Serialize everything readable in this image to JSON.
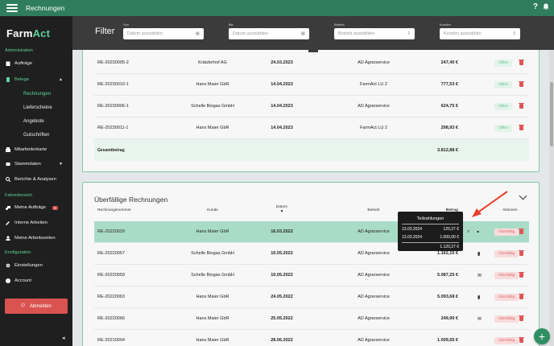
{
  "topbar": {
    "title": "Rechnungen",
    "help": "?",
    "bell": "bell-icon"
  },
  "sidebar": {
    "logo_a": "Farm",
    "logo_b": "Act",
    "section_admin": "Administration",
    "auftraege": "Aufträge",
    "belege": "Belege",
    "rechnungen": "Rechnungen",
    "lieferscheine": "Lieferscheine",
    "angebote": "Angebote",
    "gutschriften": "Gutschriften",
    "mitarbeiterkarte": "Mitarbeiterkarte",
    "stammdaten": "Stammdaten",
    "berichte": "Berichte & Analysen",
    "section_fahrer": "Fahrerbereich",
    "meine_auftraege": "Meine Aufträge",
    "meine_auftraege_badge": "4",
    "interne_arbeiten": "Interne Arbeiten",
    "arbeitszeiten": "Meine Arbeitszeiten",
    "section_konf": "Konfiguration",
    "einstellungen": "Einstellungen",
    "account": "Account",
    "abmelden": "Abmelden"
  },
  "filter": {
    "title": "Filter",
    "von_label": "Von",
    "von_placeholder": "Datum auswählen",
    "bis_label": "Bis",
    "bis_placeholder": "Datum auswählen",
    "betrieb_label": "Betrieb",
    "betrieb_placeholder": "Betrieb auswählen",
    "kunden_label": "Kunden",
    "kunden_placeholder": "Kunden auswählen"
  },
  "open_invoices": {
    "rows": [
      {
        "nr": "RE-20230005-2",
        "kunde": "Krätzlerhof AG",
        "datum": "24.03.2023",
        "betrieb": "AD Agrarservice",
        "betrag": "247,40 €",
        "status": "Offen"
      },
      {
        "nr": "RE-20230010-1",
        "kunde": "Hans Maier GbR",
        "datum": "14.04.2023",
        "betrieb": "FarmAct LU 2",
        "betrag": "777,53 €",
        "status": "Offen"
      },
      {
        "nr": "RE-20230006-1",
        "kunde": "Schelle Biogas GmbH",
        "datum": "14.04.2023",
        "betrieb": "AD Agrarservice",
        "betrag": "624,75 €",
        "status": "Offen"
      },
      {
        "nr": "RE-20230011-1",
        "kunde": "Hans Maier GbR",
        "datum": "14.04.2023",
        "betrieb": "FarmAct LU 2",
        "betrag": "298,93 €",
        "status": "Offen"
      }
    ],
    "total_label": "Gesamtbetrag",
    "total_value": "3.812,88 €"
  },
  "overdue": {
    "title": "Überfällige Rechnungen",
    "headers": {
      "nr": "Rechnungsnummer",
      "kunde": "Kunde",
      "datum": "Datum",
      "betrieb": "Betrieb",
      "betrag": "Betrag",
      "aktionen": "Aktionen"
    },
    "rows": [
      {
        "nr": "RE-20220029",
        "kunde": "Hans Maier GbR",
        "datum": "16.03.2022",
        "betrieb": "AD Agrarservice",
        "betrag": "",
        "status": "Überfällig"
      },
      {
        "nr": "RE-20220057",
        "kunde": "Schelle Biogas GmbH",
        "datum": "10.05.2022",
        "betrieb": "AD Agrarservice",
        "betrag": "1.162,15 €",
        "status": "Überfällig"
      },
      {
        "nr": "RE-20220059",
        "kunde": "Schelle Biogas GmbH",
        "datum": "10.05.2022",
        "betrieb": "AD Agrarservice",
        "betrag": "5.087,25 €",
        "status": "Überfällig"
      },
      {
        "nr": "RE-20220063",
        "kunde": "Hans Maier GbR",
        "datum": "24.05.2022",
        "betrieb": "AD Agrarservice",
        "betrag": "5.093,68 €",
        "status": "Überfällig"
      },
      {
        "nr": "RE-20220066",
        "kunde": "Hans Maier GbR",
        "datum": "25.05.2022",
        "betrieb": "AD Agrarservice",
        "betrag": "249,90 €",
        "status": "Überfällig"
      },
      {
        "nr": "RE-20210004",
        "kunde": "Hans Maier GbR",
        "datum": "28.06.2022",
        "betrieb": "AD Agrarservice",
        "betrag": "1.009,55 €",
        "status": "Überfällig"
      }
    ]
  },
  "tooltip": {
    "title": "Teilzahlungen",
    "rows": [
      {
        "date": "13.03.2024",
        "amount": "120,27 €"
      },
      {
        "date": "13.03.2024",
        "amount": "1.000,00 €"
      }
    ],
    "total": "1.120,27 €"
  },
  "colors": {
    "brand": "#2f7d5c",
    "accent": "#5ed39a",
    "danger": "#d9534f",
    "arrow": "#e8402e"
  }
}
